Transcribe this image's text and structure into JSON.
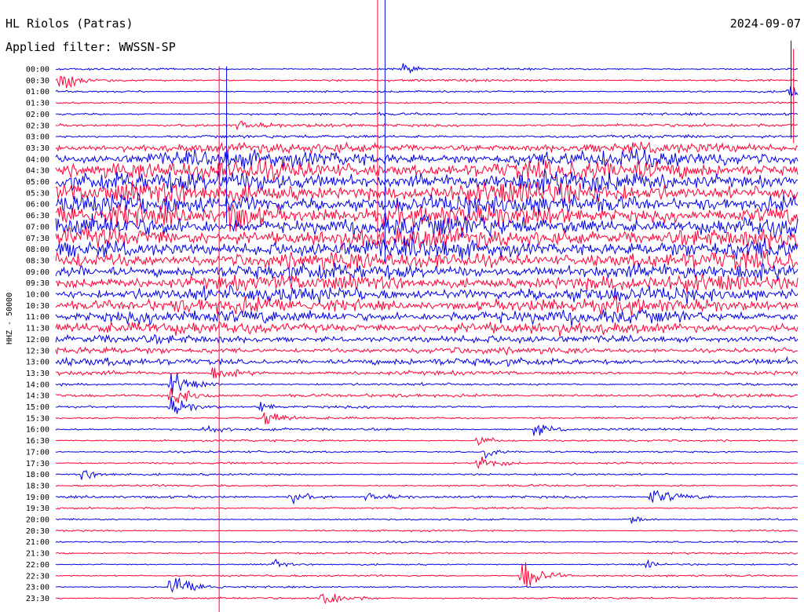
{
  "header": {
    "station": "HL Riolos (Patras)",
    "filter": "Applied filter: WWSSN-SP",
    "date": "2024-09-07"
  },
  "channel_label": "HHZ - 50000",
  "colors": {
    "blue": "#0000e6",
    "red": "#ff0033",
    "text": "#000000",
    "background": "#ffffff"
  },
  "chart_data": {
    "type": "line",
    "title": "HL Riolos (Patras)",
    "subtitle": "Applied filter: WWSSN-SP",
    "ylabel": "HHZ - 50000",
    "xlabel": "",
    "y_tick_labels": [
      "00:00",
      "00:30",
      "01:00",
      "01:30",
      "02:00",
      "02:30",
      "03:00",
      "03:30",
      "04:00",
      "04:30",
      "05:00",
      "05:30",
      "06:00",
      "06:30",
      "07:00",
      "07:30",
      "08:00",
      "08:30",
      "09:00",
      "09:30",
      "10:00",
      "10:30",
      "11:00",
      "11:30",
      "12:00",
      "12:30",
      "13:00",
      "13:30",
      "14:00",
      "14:30",
      "15:00",
      "15:30",
      "16:00",
      "16:30",
      "17:00",
      "17:30",
      "18:00",
      "18:30",
      "19:00",
      "19:30",
      "20:00",
      "20:30",
      "21:00",
      "21:30",
      "22:00",
      "22:30",
      "23:00",
      "23:30"
    ],
    "trace_colors": [
      "blue",
      "red"
    ],
    "minutes_per_line": 30,
    "trace_noise_level": [
      0.12,
      0.15,
      0.12,
      0.1,
      0.15,
      0.2,
      0.2,
      0.6,
      1.0,
      1.2,
      1.3,
      1.3,
      1.3,
      1.3,
      1.3,
      1.3,
      1.2,
      1.1,
      1.0,
      1.0,
      0.95,
      0.9,
      0.85,
      0.75,
      0.5,
      0.4,
      0.45,
      0.25,
      0.15,
      0.2,
      0.15,
      0.15,
      0.15,
      0.12,
      0.12,
      0.12,
      0.12,
      0.12,
      0.15,
      0.12,
      0.1,
      0.1,
      0.1,
      0.12,
      0.1,
      0.12,
      0.1,
      0.12
    ],
    "events": [
      {
        "line": 0,
        "minute": 14,
        "amplitude": 9,
        "duration_min": 0.3
      },
      {
        "line": 1,
        "minute": 0.1,
        "amplitude": 10,
        "duration_min": 0.7
      },
      {
        "line": 2,
        "minute": 29.6,
        "amplitude": 15,
        "duration_min": 0.3
      },
      {
        "line": 5,
        "minute": 7.3,
        "amplitude": 6,
        "duration_min": 0.6
      },
      {
        "line": 13,
        "minute": 6.9,
        "amplitude": 18,
        "duration_min": 0.8
      },
      {
        "line": 27,
        "minute": 6.3,
        "amplitude": 8,
        "duration_min": 0.8
      },
      {
        "line": 28,
        "minute": 4.6,
        "amplitude": 14,
        "duration_min": 0.7
      },
      {
        "line": 29,
        "minute": 4.6,
        "amplitude": 16,
        "duration_min": 0.7
      },
      {
        "line": 30,
        "minute": 4.6,
        "amplitude": 12,
        "duration_min": 0.7
      },
      {
        "line": 30,
        "minute": 8.2,
        "amplitude": 8,
        "duration_min": 0.4
      },
      {
        "line": 31,
        "minute": 8.4,
        "amplitude": 10,
        "duration_min": 0.5
      },
      {
        "line": 32,
        "minute": 6.0,
        "amplitude": 8,
        "duration_min": 0.4
      },
      {
        "line": 32,
        "minute": 19.3,
        "amplitude": 8,
        "duration_min": 0.5
      },
      {
        "line": 33,
        "minute": 17.0,
        "amplitude": 8,
        "duration_min": 0.5
      },
      {
        "line": 34,
        "minute": 17.3,
        "amplitude": 8,
        "duration_min": 0.4
      },
      {
        "line": 35,
        "minute": 17.0,
        "amplitude": 10,
        "duration_min": 0.6
      },
      {
        "line": 36,
        "minute": 1.0,
        "amplitude": 6,
        "duration_min": 0.7
      },
      {
        "line": 38,
        "minute": 24.0,
        "amplitude": 10,
        "duration_min": 1.0
      },
      {
        "line": 38,
        "minute": 9.4,
        "amplitude": 7,
        "duration_min": 0.6
      },
      {
        "line": 38,
        "minute": 12.5,
        "amplitude": 5,
        "duration_min": 0.8
      },
      {
        "line": 40,
        "minute": 23.2,
        "amplitude": 7,
        "duration_min": 0.4
      },
      {
        "line": 44,
        "minute": 8.8,
        "amplitude": 7,
        "duration_min": 0.3
      },
      {
        "line": 44,
        "minute": 23.8,
        "amplitude": 6,
        "duration_min": 0.3
      },
      {
        "line": 45,
        "minute": 18.8,
        "amplitude": 20,
        "duration_min": 0.7
      },
      {
        "line": 46,
        "minute": 4.6,
        "amplitude": 16,
        "duration_min": 0.8
      },
      {
        "line": 47,
        "minute": 10.6,
        "amplitude": 12,
        "duration_min": 0.8
      }
    ]
  }
}
